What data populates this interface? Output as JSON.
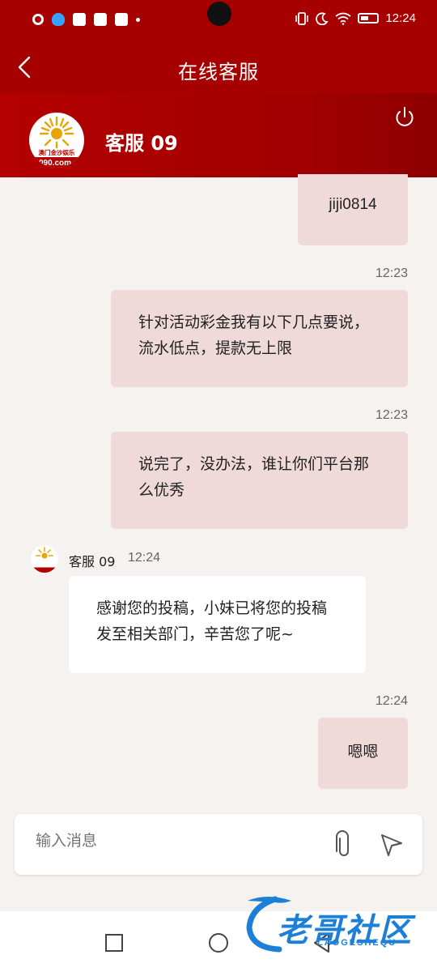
{
  "status_bar": {
    "time": "12:24"
  },
  "header": {
    "title": "在线客服",
    "agent_name": "客服 09"
  },
  "colors": {
    "header_red": "#a60000",
    "bubble_out": "#efd9d9",
    "bubble_in": "#ffffff",
    "chat_bg": "#f5f2f0",
    "watermark_blue": "#1e7fd8"
  },
  "logo": {
    "label": "澳门金沙娱乐",
    "domain": "090.com"
  },
  "messages": [
    {
      "direction": "out",
      "time": "",
      "text": "jiji0814"
    },
    {
      "direction": "out",
      "time": "12:23",
      "text": "针对活动彩金我有以下几点要说，流水低点，提款无上限"
    },
    {
      "direction": "out",
      "time": "12:23",
      "text": "说完了，没办法，谁让你们平台那么优秀"
    },
    {
      "direction": "in",
      "sender": "客服 09",
      "time": "12:24",
      "text": "感谢您的投稿，小妹已将您的投稿发至相关部门，辛苦您了呢~"
    },
    {
      "direction": "out",
      "time": "12:24",
      "text": "嗯嗯"
    }
  ],
  "input": {
    "placeholder": "输入消息"
  },
  "icons": {
    "back": "chevron-left-icon",
    "power": "power-icon",
    "attach": "paperclip-icon",
    "send": "send-icon"
  },
  "watermark": {
    "text": "老哥社区",
    "sub": "LAOGESHEQU"
  }
}
